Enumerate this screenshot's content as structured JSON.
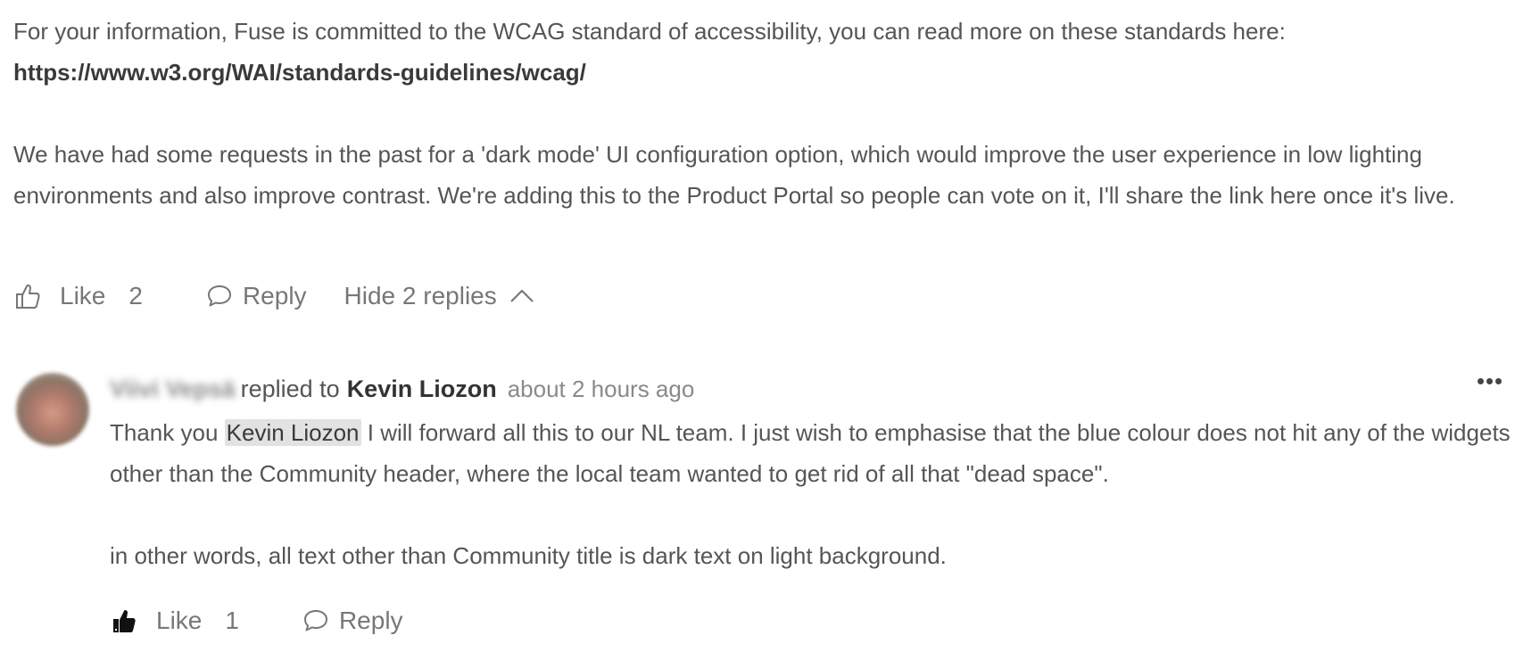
{
  "post": {
    "para1_text": "For your information, Fuse is committed to the WCAG standard of accessibility, you can read more on these standards here:",
    "link": "https://www.w3.org/WAI/standards-guidelines/wcag/",
    "para2": "We have had some requests in the past for a 'dark mode' UI configuration option, which would improve the user experience in low lighting environments and also improve contrast. We're adding this to the Product Portal so people can vote on it, I'll share the link here once it's live.",
    "actions": {
      "like_label": "Like",
      "like_count": "2",
      "reply_label": "Reply",
      "hide_replies_label": "Hide 2 replies"
    }
  },
  "reply": {
    "author": "Viivi Vepsä",
    "replied_to_text": "replied to",
    "target": "Kevin Liozon",
    "time": "about 2 hours ago",
    "body_prefix": "Thank you",
    "mention": "Kevin Liozon",
    "body_rest": " I will forward all this to our NL team. I just wish to emphasise that the blue colour does not hit any of the widgets other than the Community header, where the local team wanted to get rid of all that \"dead space\".",
    "body_second": "in other words, all text other than Community title is dark text on light background.",
    "actions": {
      "like_label": "Like",
      "like_count": "1",
      "reply_label": "Reply"
    }
  },
  "icons": {
    "like_outline": "thumbs-up-outline-icon",
    "like_filled": "thumbs-up-filled-icon",
    "reply": "speech-bubble-icon",
    "chevron": "chevron-up-icon",
    "more": "more-horizontal-icon"
  },
  "colors": {
    "text": "#555555",
    "link": "#3a3a3a",
    "muted": "#777777",
    "mention_bg": "#e2e2e2"
  }
}
